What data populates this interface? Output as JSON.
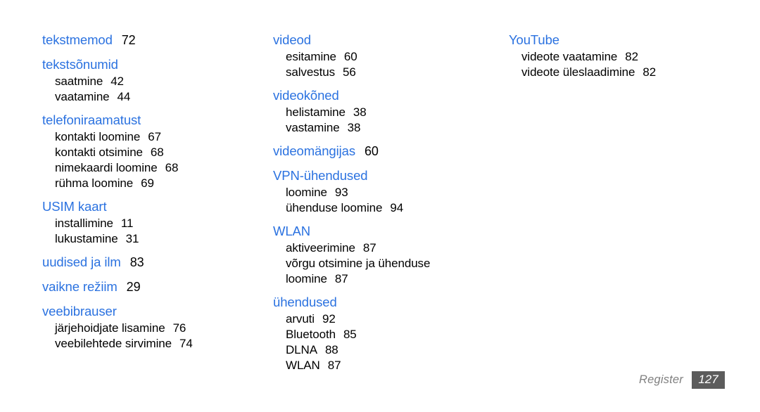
{
  "document": {
    "title": "Register",
    "language": "Estonian index page"
  },
  "footer": {
    "label": "Register",
    "page_number": "127",
    "box_color": "#5c5c5c",
    "label_color": "#808080"
  },
  "theme": {
    "heading_color": "#2b72e0",
    "text_color": "#000000",
    "background": "#ffffff"
  },
  "columns": [
    {
      "id": "column-1",
      "groups": [
        {
          "heading": "tekstmemod",
          "heading_page": "72",
          "subentries": []
        },
        {
          "heading": "tekstsõnumid",
          "heading_page": "",
          "subentries": [
            {
              "label": "saatmine",
              "page": "42"
            },
            {
              "label": "vaatamine",
              "page": "44"
            }
          ]
        },
        {
          "heading": "telefoniraamatust",
          "heading_page": "",
          "subentries": [
            {
              "label": "kontakti loomine",
              "page": "67"
            },
            {
              "label": "kontakti otsimine",
              "page": "68"
            },
            {
              "label": "nimekaardi loomine",
              "page": "68"
            },
            {
              "label": "rühma loomine",
              "page": "69"
            }
          ]
        },
        {
          "heading": "USIM kaart",
          "heading_page": "",
          "subentries": [
            {
              "label": "installimine",
              "page": "11"
            },
            {
              "label": "lukustamine",
              "page": "31"
            }
          ]
        },
        {
          "heading": "uudised ja ilm",
          "heading_page": "83",
          "subentries": []
        },
        {
          "heading": "vaikne režiim",
          "heading_page": "29",
          "subentries": []
        },
        {
          "heading": "veebibrauser",
          "heading_page": "",
          "subentries": [
            {
              "label": "järjehoidjate lisamine",
              "page": "76"
            },
            {
              "label": "veebilehtede sirvimine",
              "page": "74"
            }
          ]
        }
      ]
    },
    {
      "id": "column-2",
      "groups": [
        {
          "heading": "videod",
          "heading_page": "",
          "subentries": [
            {
              "label": "esitamine",
              "page": "60"
            },
            {
              "label": "salvestus",
              "page": "56"
            }
          ]
        },
        {
          "heading": "videokõned",
          "heading_page": "",
          "subentries": [
            {
              "label": "helistamine",
              "page": "38"
            },
            {
              "label": "vastamine",
              "page": "38"
            }
          ]
        },
        {
          "heading": "videomängijas",
          "heading_page": "60",
          "subentries": []
        },
        {
          "heading": "VPN-ühendused",
          "heading_page": "",
          "subentries": [
            {
              "label": "loomine",
              "page": "93"
            },
            {
              "label": "ühenduse loomine",
              "page": "94"
            }
          ]
        },
        {
          "heading": "WLAN",
          "heading_page": "",
          "subentries": [
            {
              "label": "aktiveerimine",
              "page": "87"
            },
            {
              "label": "võrgu otsimine ja ühenduse",
              "page": ""
            },
            {
              "label": "loomine",
              "page": "87"
            }
          ]
        },
        {
          "heading": "ühendused",
          "heading_page": "",
          "subentries": [
            {
              "label": "arvuti",
              "page": "92"
            },
            {
              "label": "Bluetooth",
              "page": "85"
            },
            {
              "label": "DLNA",
              "page": "88"
            },
            {
              "label": "WLAN",
              "page": "87"
            }
          ]
        }
      ]
    },
    {
      "id": "column-3",
      "groups": [
        {
          "heading": "YouTube",
          "heading_page": "",
          "subentries": [
            {
              "label": "videote vaatamine",
              "page": "82"
            },
            {
              "label": "videote üleslaadimine",
              "page": "82"
            }
          ]
        }
      ]
    }
  ]
}
